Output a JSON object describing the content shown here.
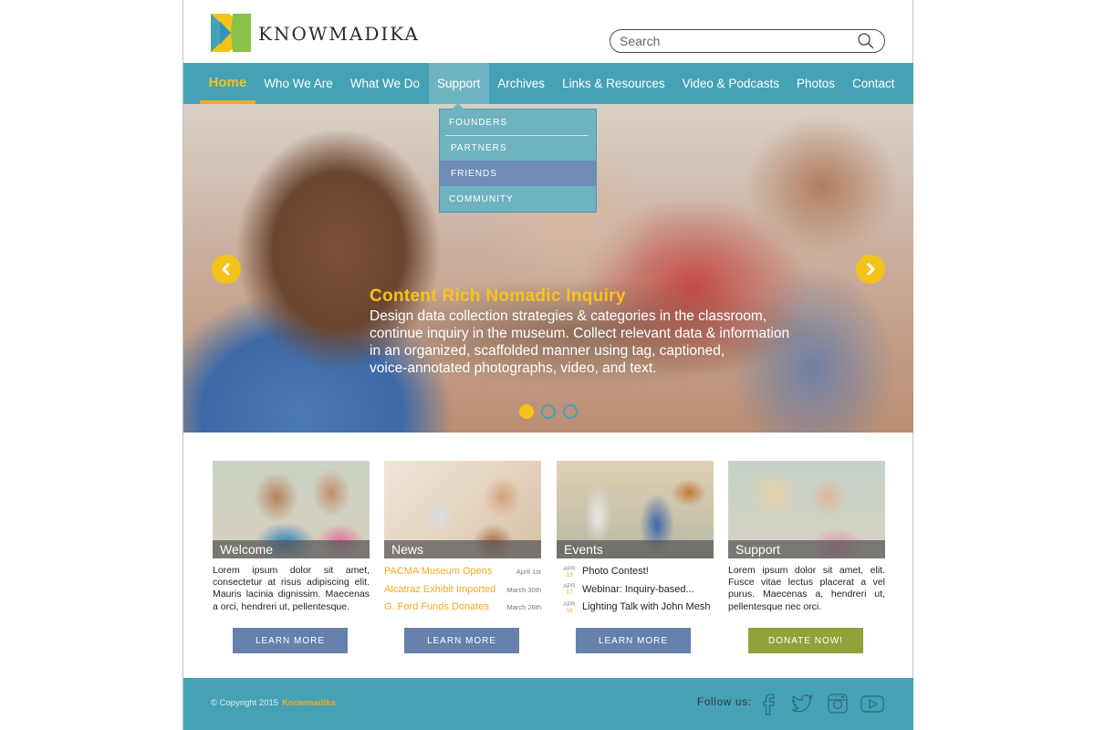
{
  "brand": {
    "name": "KNOWMADIKA"
  },
  "search": {
    "placeholder": "Search"
  },
  "nav": {
    "items": [
      {
        "label": "Home",
        "state": "active"
      },
      {
        "label": "Who We Are"
      },
      {
        "label": "What We Do"
      },
      {
        "label": "Support",
        "state": "hover"
      },
      {
        "label": "Archives"
      },
      {
        "label": "Links & Resources"
      },
      {
        "label": "Video & Podcasts"
      },
      {
        "label": "Photos"
      },
      {
        "label": "Contact"
      }
    ]
  },
  "dropdown": {
    "items": [
      {
        "label": "FOUNDERS"
      },
      {
        "label": "PARTNERS"
      },
      {
        "label": "FRIENDS",
        "highlighted": true
      },
      {
        "label": "COMMUNITY"
      }
    ]
  },
  "hero": {
    "title": "Content Rich Nomadic Inquiry",
    "lines": [
      "Design data collection strategies & categories in the classroom,",
      "continue inquiry in the museum. Collect relevant data & information",
      "in an organized, scaffolded manner using tag, captioned,",
      "voice-annotated photographs, video, and text."
    ],
    "slides": 3,
    "active_slide": 1
  },
  "cards": {
    "welcome": {
      "caption": "Welcome",
      "text": "Lorem ipsum dolor sit amet, consectetur at risus adipiscing elit. Mauris lacinia dignissim. Maecenas a orci, hendreri ut, pellentesque.",
      "button": "LEARN MORE"
    },
    "news": {
      "caption": "News",
      "items": [
        {
          "title": "PACMA Museum Opens",
          "date": "April 1st"
        },
        {
          "title": "Alcatraz Exhibit Imported",
          "date": "March 30th"
        },
        {
          "title": "G. Ford Funds Donates",
          "date": "March 26th"
        }
      ],
      "button": "LEARN MORE"
    },
    "events": {
      "caption": "Events",
      "items": [
        {
          "month": "APR",
          "day": "13",
          "title": "Photo Contest!"
        },
        {
          "month": "APR",
          "day": "17",
          "title": "Webinar: Inquiry-based..."
        },
        {
          "month": "APR",
          "day": "19",
          "title": "Lighting Talk with John Mesh"
        }
      ],
      "button": "LEARN MORE"
    },
    "support": {
      "caption": "Support",
      "text": "Lorem ipsum dolor sit amet, elit. Fusce vitae lectus placerat a vel purus. Maecenas a, hendreri ut, pellentesque nec orci.",
      "button": "DONATE NOW!"
    }
  },
  "footer": {
    "copyright": "© Copyright 2015",
    "brand": "Knowmadika",
    "follow": "Follow us:",
    "social": [
      "facebook-icon",
      "twitter-icon",
      "instagram-icon",
      "youtube-icon"
    ]
  },
  "colors": {
    "teal": "#45a2b5",
    "yellow": "#f3c319",
    "orange": "#f7a823",
    "slate_blue": "#6681ac",
    "olive": "#8fa338"
  }
}
